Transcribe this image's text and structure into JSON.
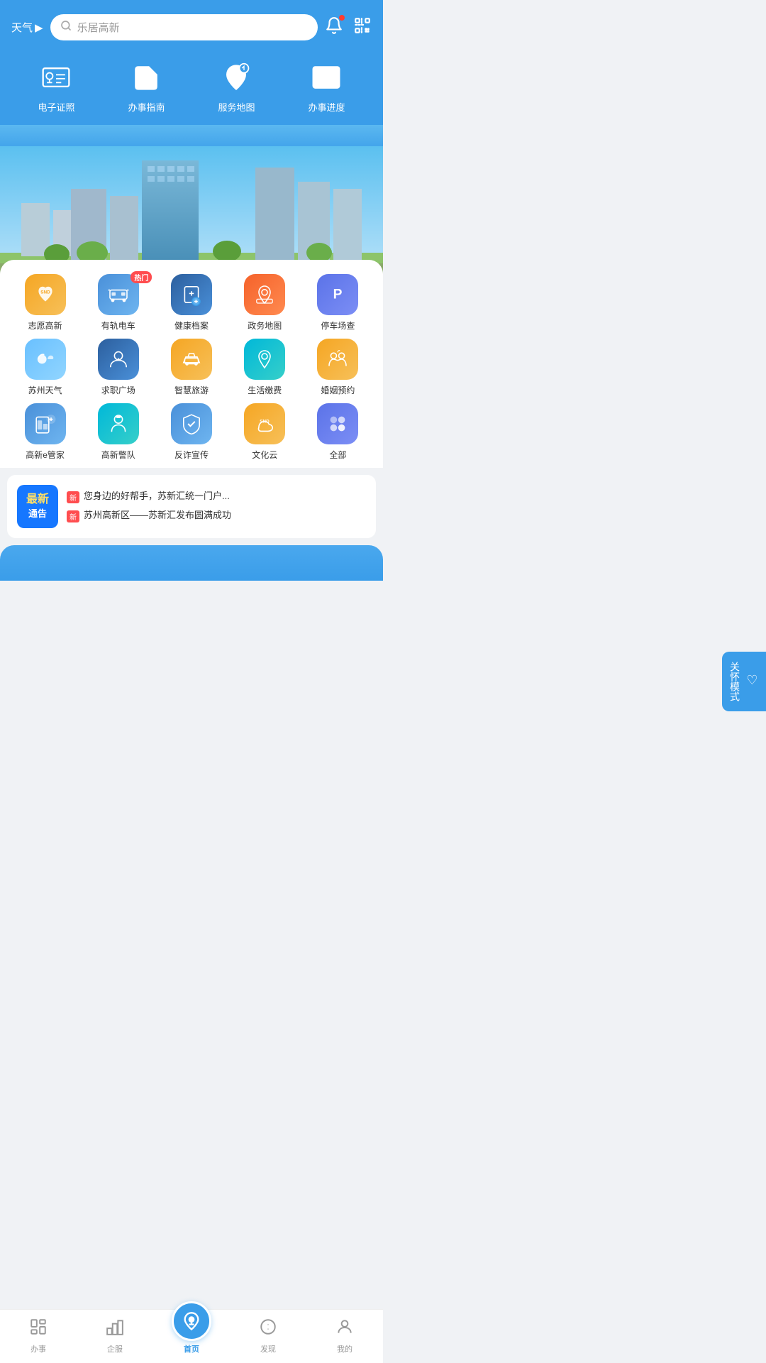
{
  "header": {
    "weather_label": "天气",
    "weather_arrow": "▶",
    "search_placeholder": "乐居高新",
    "notification_icon": "bell",
    "scan_icon": "scan"
  },
  "quick_actions": [
    {
      "id": "electronic-id",
      "label": "电子证照",
      "icon": "id"
    },
    {
      "id": "affairs-guide",
      "label": "办事指南",
      "icon": "guide"
    },
    {
      "id": "service-map",
      "label": "服务地图",
      "icon": "map"
    },
    {
      "id": "affairs-progress",
      "label": "办事进度",
      "icon": "progress"
    }
  ],
  "services": [
    {
      "id": "volunteer",
      "label": "志愿高新",
      "icon": "❤",
      "color": "icon-orange",
      "hot": false
    },
    {
      "id": "rail-transit",
      "label": "有轨电车",
      "icon": "🚃",
      "color": "icon-blue",
      "hot": true
    },
    {
      "id": "health-records",
      "label": "健康档案",
      "icon": "🏥",
      "color": "icon-dark-blue",
      "hot": false
    },
    {
      "id": "gov-map",
      "label": "政务地图",
      "icon": "🗺",
      "color": "icon-red-orange",
      "hot": false
    },
    {
      "id": "parking",
      "label": "停车场查",
      "icon": "P",
      "color": "icon-purple-blue",
      "hot": false
    },
    {
      "id": "suzhou-weather",
      "label": "苏州天气",
      "icon": "⛅",
      "color": "icon-light-blue",
      "hot": false
    },
    {
      "id": "job-plaza",
      "label": "求职广场",
      "icon": "👤",
      "color": "icon-dark-blue",
      "hot": false
    },
    {
      "id": "smart-tourism",
      "label": "智慧旅游",
      "icon": "🚗",
      "color": "icon-orange",
      "hot": false
    },
    {
      "id": "life-payment",
      "label": "生活缴费",
      "icon": "💳",
      "color": "icon-teal",
      "hot": false
    },
    {
      "id": "marriage",
      "label": "婚姻预约",
      "icon": "👫",
      "color": "icon-orange",
      "hot": false
    },
    {
      "id": "e-manager",
      "label": "高新e管家",
      "icon": "📊",
      "color": "icon-blue",
      "hot": false
    },
    {
      "id": "police",
      "label": "高新警队",
      "icon": "👮",
      "color": "icon-teal",
      "hot": false
    },
    {
      "id": "anti-fraud",
      "label": "反诈宣传",
      "icon": "🛡",
      "color": "icon-blue",
      "hot": false
    },
    {
      "id": "culture-cloud",
      "label": "文化云",
      "icon": "☁",
      "color": "icon-orange",
      "hot": false
    },
    {
      "id": "all",
      "label": "全部",
      "icon": "⋯",
      "color": "icon-purple-blue",
      "hot": false
    }
  ],
  "care_mode": {
    "icon": "♡",
    "label": "关怀模式"
  },
  "news": {
    "badge_top": "最新",
    "badge_bottom": "通告",
    "items": [
      {
        "tag": "新",
        "text": "您身边的好帮手，苏新汇统一门户..."
      },
      {
        "tag": "新",
        "text": "苏州高新区——苏新汇发布圆满成功"
      }
    ]
  },
  "tabs": [
    {
      "id": "affairs",
      "label": "办事",
      "icon": "📋",
      "active": false
    },
    {
      "id": "enterprise",
      "label": "企服",
      "icon": "🏢",
      "active": false
    },
    {
      "id": "home",
      "label": "首页",
      "icon": "🏠",
      "active": true,
      "center": true
    },
    {
      "id": "discover",
      "label": "发现",
      "icon": "🔍",
      "active": false
    },
    {
      "id": "mine",
      "label": "我的",
      "icon": "👤",
      "active": false
    }
  ]
}
